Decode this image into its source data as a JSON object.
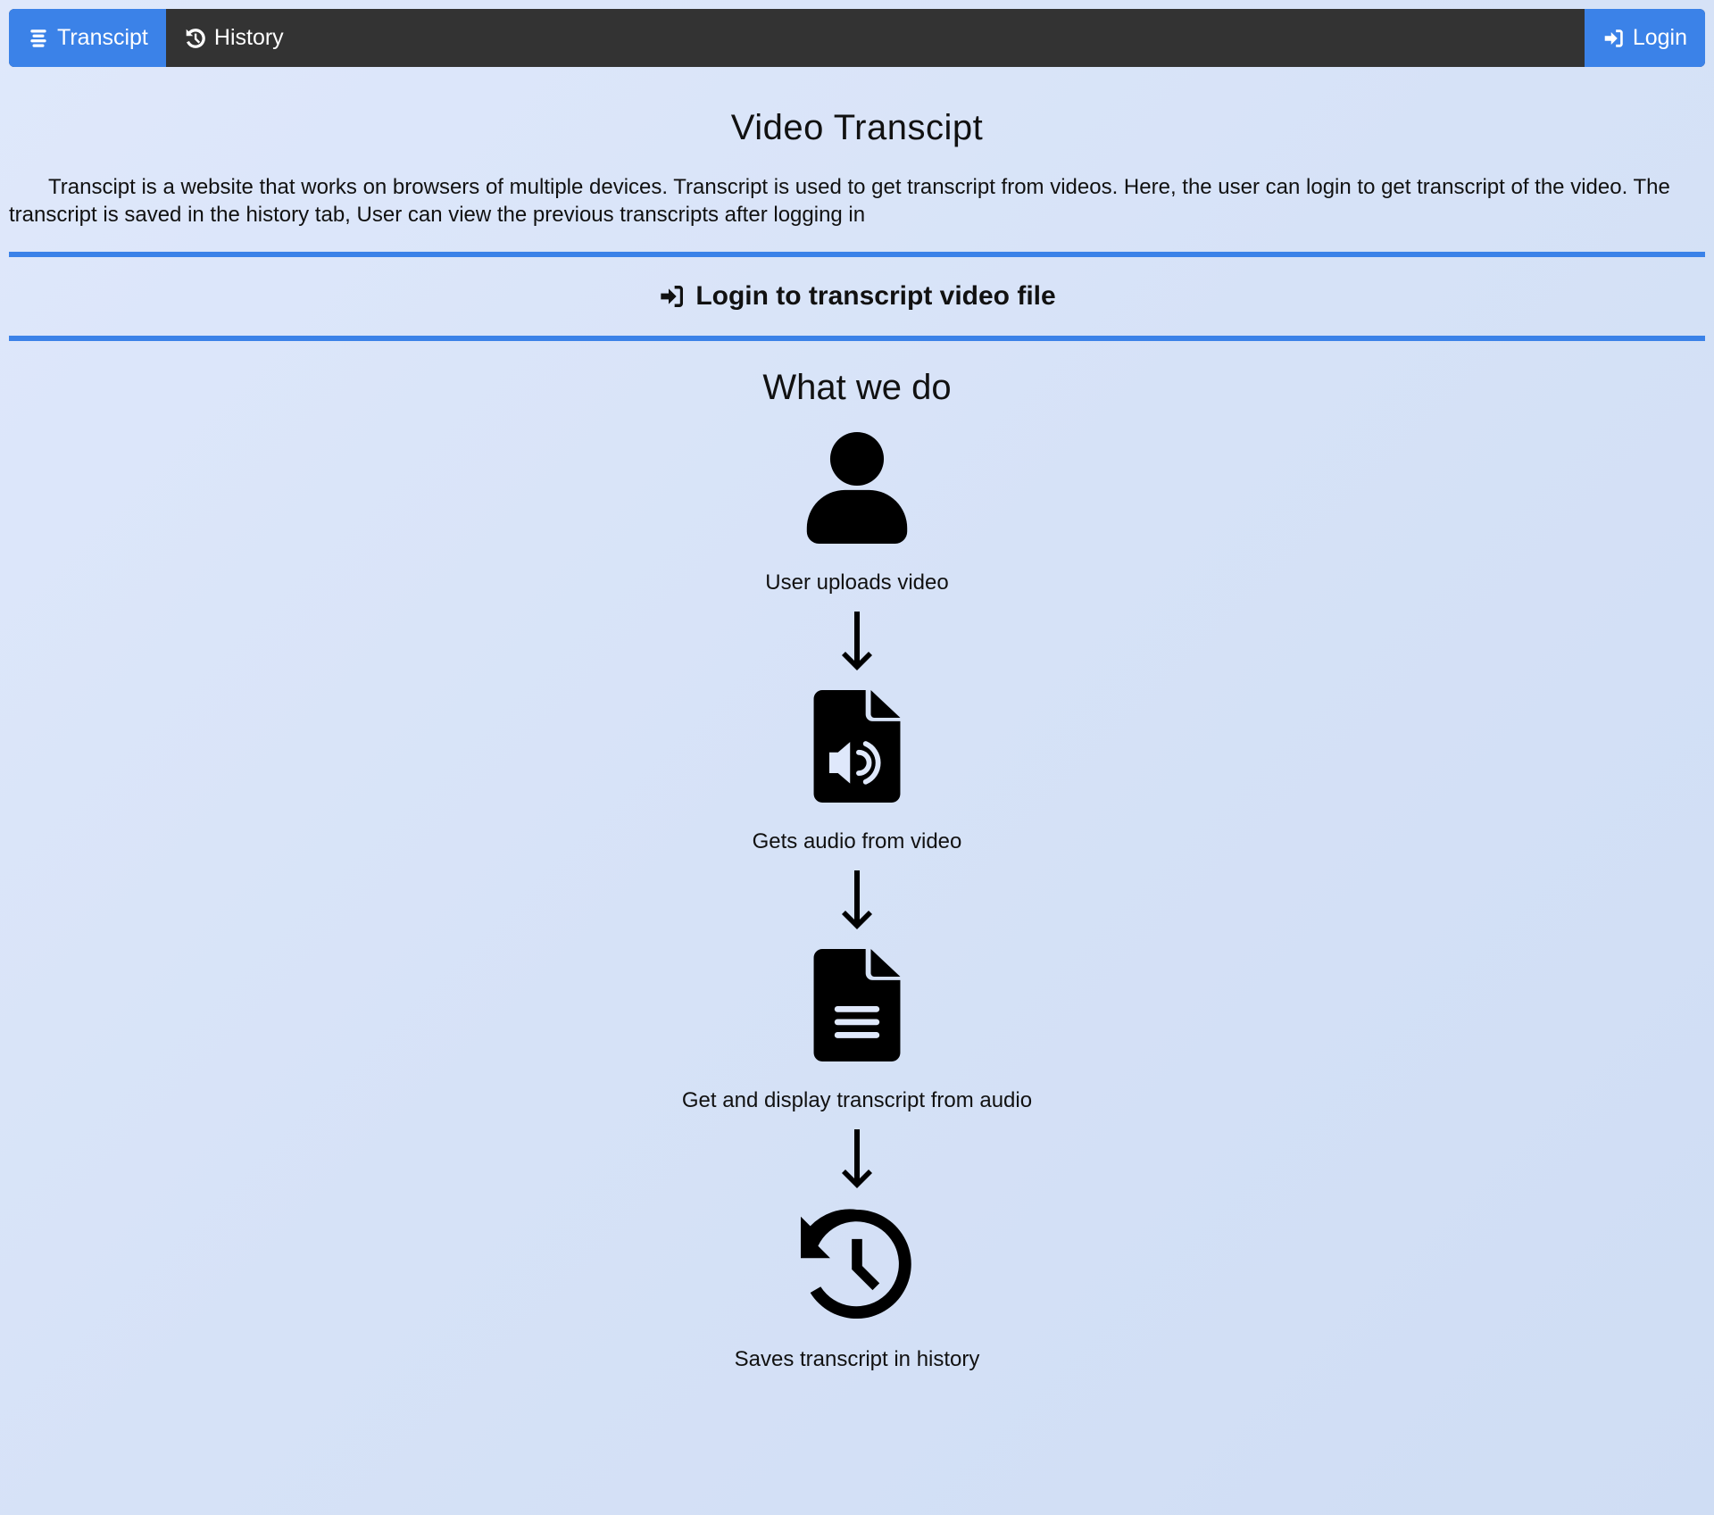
{
  "nav": {
    "brand_label": "Transcipt",
    "history_label": "History",
    "login_label": "Login",
    "active_color": "#3b82e8",
    "bar_color": "#333333"
  },
  "hero": {
    "title": "Video Transcipt",
    "intro": "Transcipt is a website that works on browsers of multiple devices. Transcript is used to get transcript from videos. Here, the user can login to get transcript of the video. The transcript is saved in the history tab, User can view the previous transcripts after logging in"
  },
  "login_banner": {
    "label": "Login to transcript video file",
    "icon": "sign-in-icon"
  },
  "what_we_do": {
    "title": "What we do",
    "steps": [
      {
        "icon": "user-icon",
        "label": "User uploads video"
      },
      {
        "icon": "file-audio-icon",
        "label": "Gets audio from video"
      },
      {
        "icon": "file-lines-icon",
        "label": "Get and display transcript from audio"
      },
      {
        "icon": "history-icon",
        "label": "Saves transcript in history"
      }
    ]
  }
}
